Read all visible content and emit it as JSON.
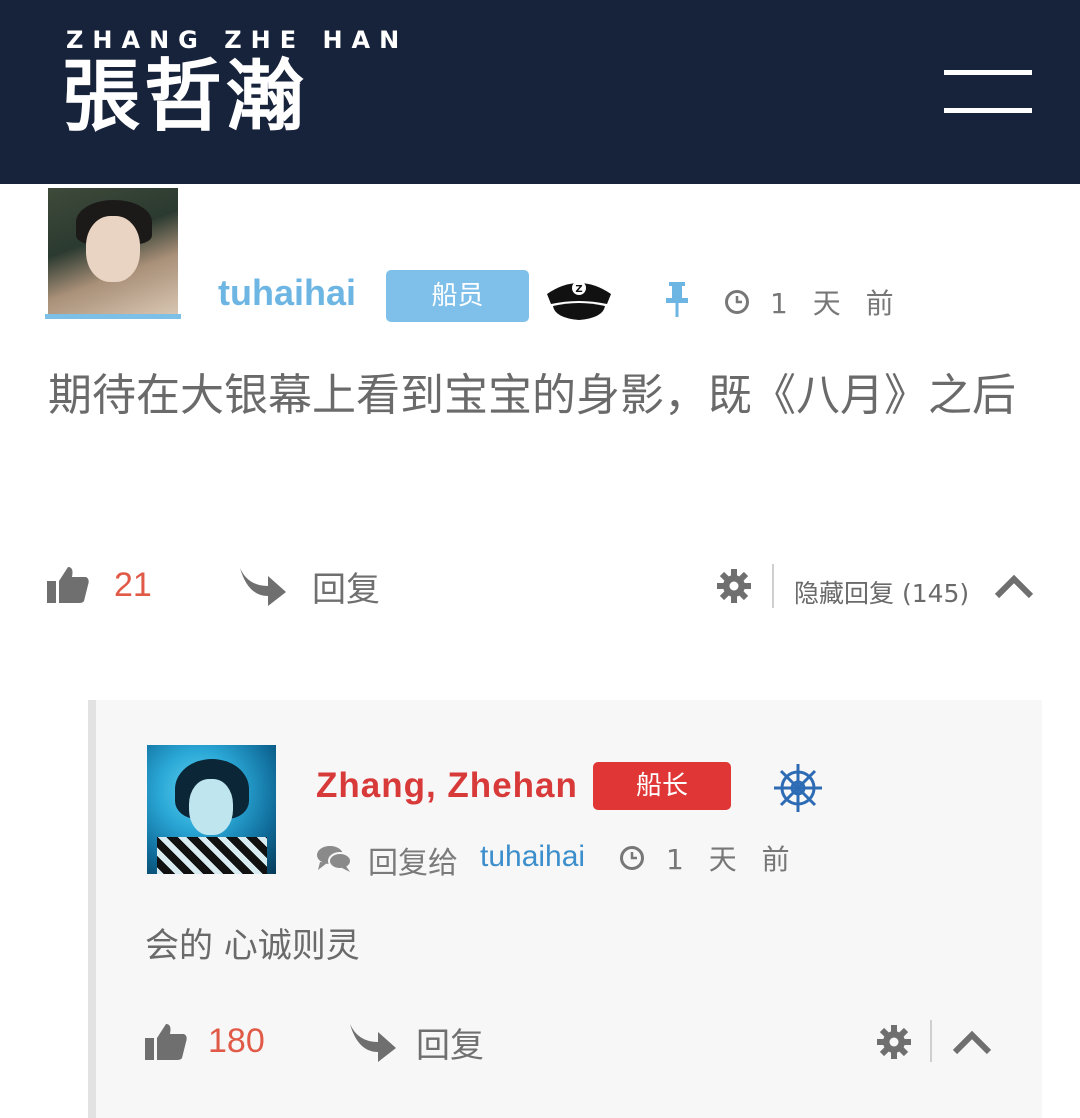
{
  "header": {
    "brand_sub": "ZHANG ZHE HAN",
    "brand_main": "張哲瀚",
    "menu_icon": "hamburger-menu-icon"
  },
  "comment": {
    "username": "tuhaihai",
    "badge": "船员",
    "badge_color": "#7fc0ea",
    "time": "1 天 前",
    "text": "期待在大银幕上看到宝宝的身影，既《八月》之后",
    "likes": "21",
    "reply_label": "回复",
    "hide_replies": "隐藏回复 (145)"
  },
  "reply": {
    "username": "Zhang, Zhehan",
    "username_color": "#d83a3a",
    "badge": "船长",
    "badge_color": "#e03636",
    "reply_to_label": "回复给",
    "reply_to_user": "tuhaihai",
    "time": "1 天 前",
    "text": "会的 心诚则灵",
    "likes": "180",
    "reply_label": "回复"
  }
}
